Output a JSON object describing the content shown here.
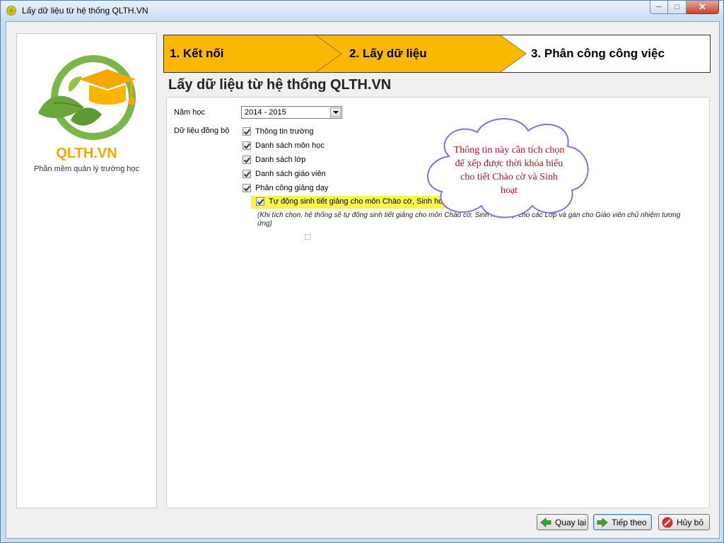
{
  "window": {
    "title": "Lấy dữ liệu từ hệ thống QLTH.VN"
  },
  "brand": {
    "name": "QLTH.VN",
    "tagline": "Phần mềm quản lý trường học"
  },
  "steps": [
    {
      "label": "1. Kết nối",
      "state": "done"
    },
    {
      "label": "2. Lấy dữ liệu",
      "state": "active"
    },
    {
      "label": "3. Phân công công việc",
      "state": "pending"
    }
  ],
  "page": {
    "heading": "Lấy dữ liệu từ hệ thống QLTH.VN"
  },
  "form": {
    "year_label": "Năm học",
    "year_value": "2014 - 2015",
    "sync_label": "Dữ liệu đồng bộ",
    "options": [
      {
        "label": "Thông tin trường",
        "checked": true
      },
      {
        "label": "Danh sách môn học",
        "checked": true
      },
      {
        "label": "Danh sách lớp",
        "checked": true
      },
      {
        "label": "Danh sách giáo viên",
        "checked": true
      },
      {
        "label": "Phân công giảng dạy",
        "checked": true
      }
    ],
    "auto_option": {
      "label": "Tự động sinh tiết giảng cho môn Chào cờ, Sinh hoạt lớp",
      "checked": true
    },
    "note": "(Khi tích chọn, hệ thống sẽ tự động sinh tiết giảng cho môn Chào cờ, Sinh hoạt lớp cho các Lớp và gán cho Giáo viên chủ nhiệm tương ứng)"
  },
  "callout": {
    "text": "Thông tin này cần tích chọn để xếp được thời khóa biểu cho tiết Chào cờ và Sinh hoạt"
  },
  "buttons": {
    "back": "Quay lại",
    "next": "Tiếp theo",
    "cancel": "Hủy bỏ"
  },
  "colors": {
    "step_active": "#fbb800",
    "brand": "#f5a800",
    "highlight": "#f7f54a",
    "callout_text": "#b5121b"
  },
  "icons": {
    "back": "arrow-left-icon",
    "next": "arrow-right-icon",
    "cancel": "cancel-icon"
  }
}
